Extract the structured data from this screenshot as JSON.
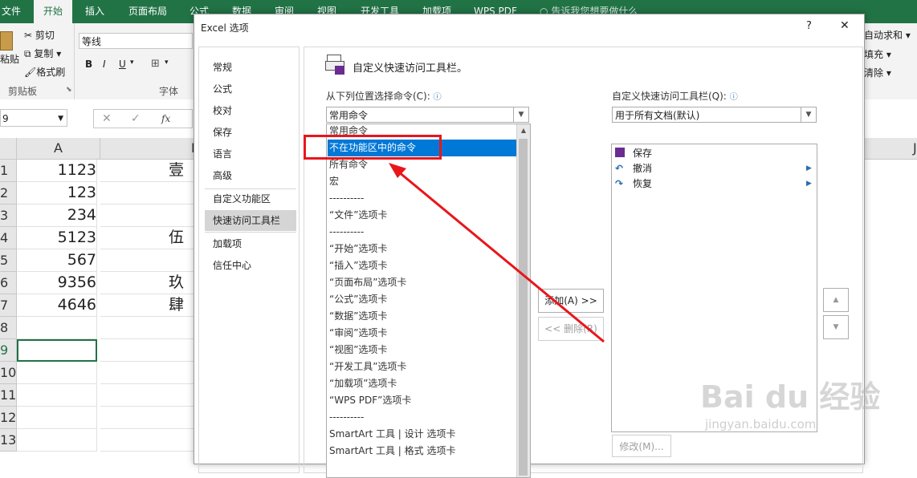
{
  "ribbon": {
    "tabs": [
      "文件",
      "开始",
      "插入",
      "页面布局",
      "公式",
      "数据",
      "审阅",
      "视图",
      "开发工具",
      "加载项",
      "WPS PDF"
    ],
    "search_placeholder": "告诉我您想要做什么",
    "clipboard": {
      "cut": "剪切",
      "copy": "复制",
      "format_painter": "格式刷",
      "paste": "粘贴",
      "group_label": "剪贴板"
    },
    "font": {
      "name": "等线",
      "group_label": "字体",
      "bold": "B",
      "italic": "I",
      "underline": "U"
    },
    "right": {
      "autosum": "自动求和",
      "fill": "填充",
      "clear": "清除"
    }
  },
  "formula_bar": {
    "namebox": "9",
    "fx": "fx"
  },
  "sheet": {
    "col_a": "A",
    "col_b": "B",
    "col_j": "J",
    "rows": [
      {
        "n": "1",
        "a": "1123",
        "b": "壹仟"
      },
      {
        "n": "2",
        "a": "123",
        "b": ""
      },
      {
        "n": "3",
        "a": "234",
        "b": ""
      },
      {
        "n": "4",
        "a": "5123",
        "b": "伍仟"
      },
      {
        "n": "5",
        "a": "567",
        "b": ""
      },
      {
        "n": "6",
        "a": "9356",
        "b": "玖仟"
      },
      {
        "n": "7",
        "a": "4646",
        "b": "肆仟"
      },
      {
        "n": "8",
        "a": "",
        "b": ""
      },
      {
        "n": "9",
        "a": "",
        "b": ""
      },
      {
        "n": "10",
        "a": "",
        "b": ""
      },
      {
        "n": "11",
        "a": "",
        "b": ""
      },
      {
        "n": "12",
        "a": "",
        "b": ""
      },
      {
        "n": "13",
        "a": "",
        "b": ""
      }
    ]
  },
  "dialog": {
    "title": "Excel 选项",
    "help": "?",
    "close": "✕",
    "nav": [
      "常规",
      "公式",
      "校对",
      "保存",
      "语言",
      "高级",
      "自定义功能区",
      "快速访问工具栏",
      "加载项",
      "信任中心"
    ],
    "heading": "自定义快速访问工具栏。",
    "choose_label": "从下列位置选择命令(C):",
    "choose_value": "常用命令",
    "commands": [
      "常用命令",
      "不在功能区中的命令",
      "所有命令",
      "宏",
      "----------",
      "“文件”选项卡",
      "----------",
      "“开始”选项卡",
      "“插入”选项卡",
      "“页面布局”选项卡",
      "“公式”选项卡",
      "“数据”选项卡",
      "“审阅”选项卡",
      "“视图”选项卡",
      "“开发工具”选项卡",
      "“加载项”选项卡",
      "“WPS PDF”选项卡",
      "----------",
      "SmartArt 工具 | 设计 选项卡",
      "SmartArt 工具 | 格式 选项卡"
    ],
    "qat_label": "自定义快速访问工具栏(Q):",
    "qat_value": "用于所有文档(默认)",
    "qat_items": [
      "保存",
      "撤消",
      "恢复"
    ],
    "add_button": "添加(A) >>",
    "remove_button": "<< 删除(R)",
    "modify_button": "修改(M)..."
  },
  "watermark": {
    "brand": "Bai du 经验",
    "url": "jingyan.baidu.com"
  },
  "colors": {
    "excel_green": "#217346",
    "highlight_red": "#e8161b",
    "selection_blue": "#0078d7"
  }
}
